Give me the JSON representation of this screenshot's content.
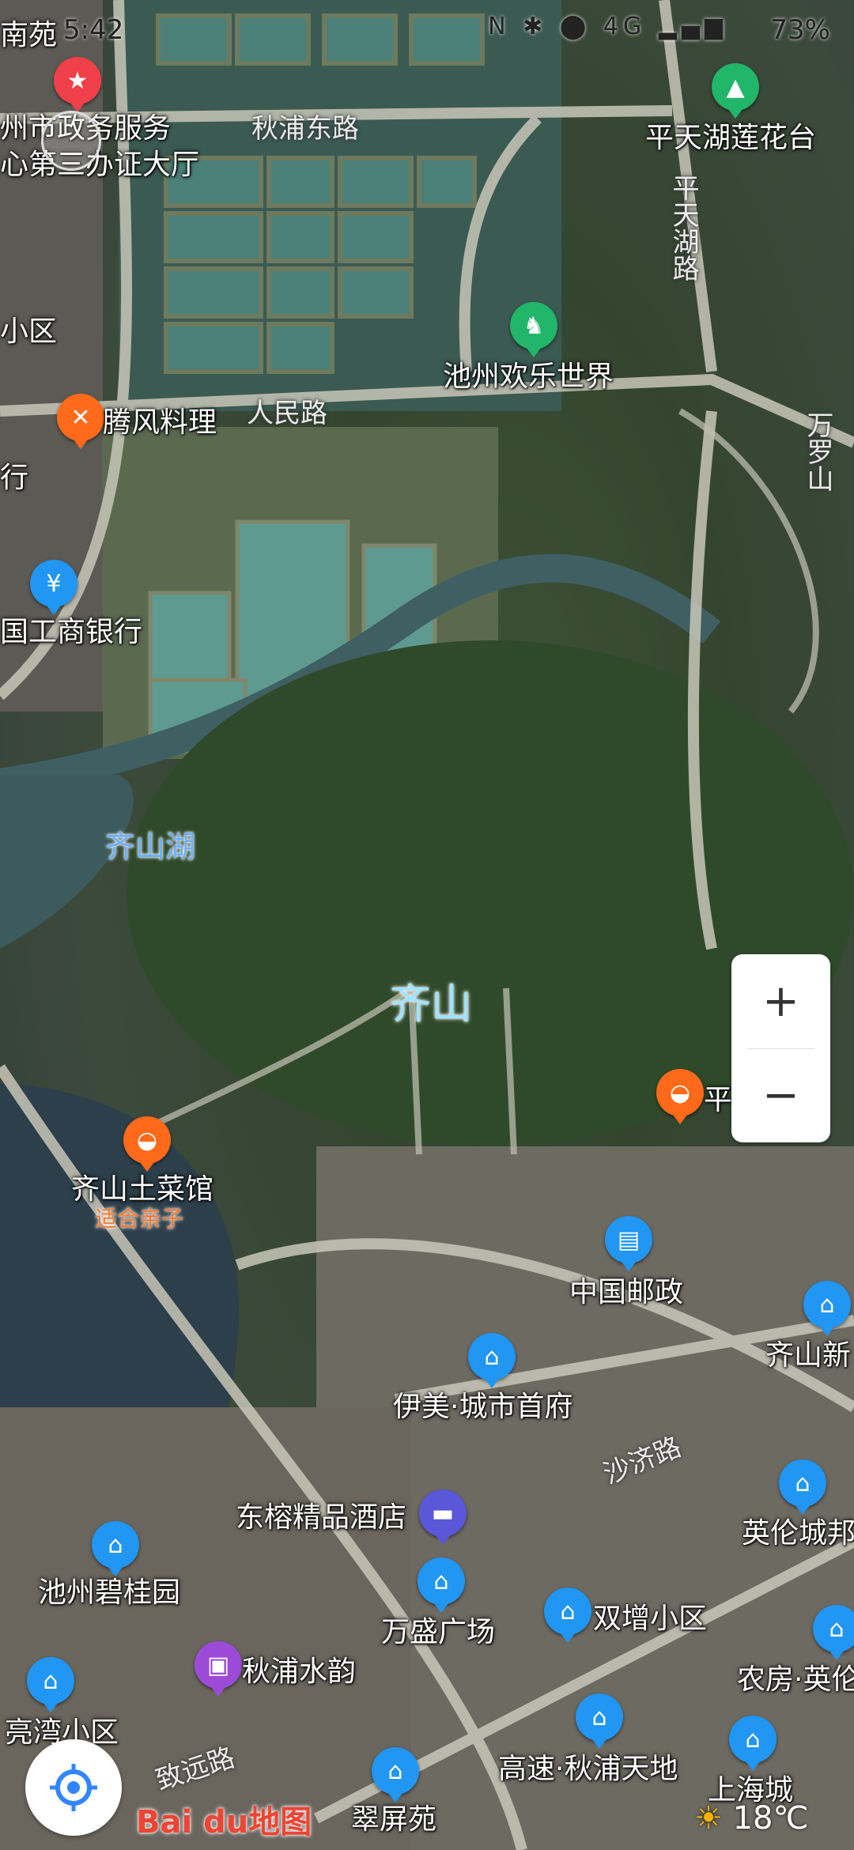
{
  "status_bar": {
    "time": "5:42",
    "icons": "N ✱ ⬤ 4G ▂▄▆",
    "battery": "73%"
  },
  "map": {
    "roads": [
      "秋浦东路",
      "人民路",
      "平天湖路",
      "万罗山",
      "沙济路",
      "致远路"
    ],
    "lake": "齐山湖",
    "mountain": "齐山",
    "pois": [
      {
        "label": "南苑"
      },
      {
        "label": "州市政务服务\n心第三办证大厅"
      },
      {
        "label": "平天湖莲花台"
      },
      {
        "label": "小区"
      },
      {
        "label": "池州欢乐世界"
      },
      {
        "label": "腾风料理"
      },
      {
        "label": "行"
      },
      {
        "label": "国工商银行"
      },
      {
        "label": "平"
      },
      {
        "label": "齐山土菜馆"
      },
      {
        "label": "适合亲子"
      },
      {
        "label": "中国邮政"
      },
      {
        "label": "齐山新"
      },
      {
        "label": "伊美·城市首府"
      },
      {
        "label": "英伦城邦"
      },
      {
        "label": "东榕精品酒店"
      },
      {
        "label": "池州碧桂园"
      },
      {
        "label": "万盛广场"
      },
      {
        "label": "双增小区"
      },
      {
        "label": "秋浦水韵"
      },
      {
        "label": "农房·英伦"
      },
      {
        "label": "亮湾小区"
      },
      {
        "label": "高速·秋浦天地"
      },
      {
        "label": "上海城"
      },
      {
        "label": "翠屏苑"
      }
    ]
  },
  "controls": {
    "zoom_in": "+",
    "zoom_out": "−"
  },
  "logo": "Bai du地图",
  "weather": {
    "temp": "18℃"
  }
}
